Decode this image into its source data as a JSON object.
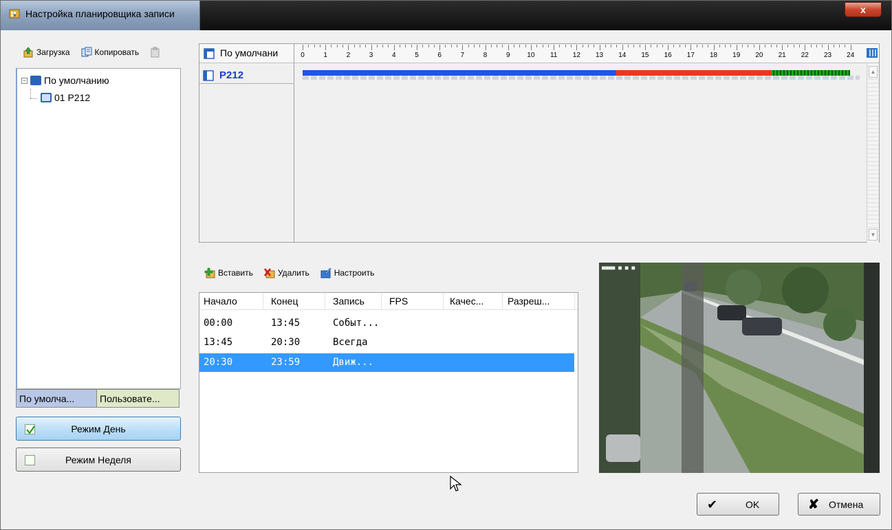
{
  "window": {
    "title": "Настройка планировщика записи",
    "close_glyph": "x"
  },
  "tree_toolbar": {
    "load_label": "Загрузка",
    "copy_label": "Копировать",
    "paste_icon": "paste-icon"
  },
  "tree": {
    "root_label": "По умолчанию",
    "child_label": "01 P212"
  },
  "left_tabs": {
    "default_tab": "По умолча...",
    "custom_tab": "Пользовате..."
  },
  "modes": {
    "day_label": "Режим День",
    "day_checked": true,
    "week_label": "Режим Неделя",
    "week_checked": false
  },
  "schedule_grid": {
    "header_name": "По умолчани",
    "hours": [
      "0",
      "1",
      "2",
      "3",
      "4",
      "5",
      "6",
      "7",
      "8",
      "9",
      "10",
      "11",
      "12",
      "13",
      "14",
      "15",
      "16",
      "17",
      "18",
      "19",
      "20",
      "21",
      "22",
      "23",
      "24"
    ],
    "camera_name": "P212",
    "segments": [
      {
        "start": "00:00",
        "end": "13:45",
        "color": "#1f56e0",
        "style": "solid"
      },
      {
        "start": "13:45",
        "end": "20:30",
        "color": "#e8391b",
        "style": "solid"
      },
      {
        "start": "20:30",
        "end": "23:59",
        "color": "#19a819",
        "style": "dotted"
      }
    ]
  },
  "table_toolbar": {
    "insert_label": "Вставить",
    "delete_label": "Удалить",
    "configure_label": "Настроить"
  },
  "table": {
    "columns": [
      "Начало",
      "Конец",
      "Запись",
      "FPS",
      "Качес...",
      "Разреш..."
    ],
    "rows": [
      {
        "start": "00:00",
        "end": "13:45",
        "record": "Событ...",
        "selected": false
      },
      {
        "start": "13:45",
        "end": "20:30",
        "record": "Всегда",
        "selected": false
      },
      {
        "start": "20:30",
        "end": "23:59",
        "record": "Движ...",
        "selected": true
      }
    ]
  },
  "buttons": {
    "ok_label": "OK",
    "cancel_label": "Отмена"
  },
  "colors": {
    "selection": "#3399ff",
    "camera_name": "#1b3fc8"
  }
}
